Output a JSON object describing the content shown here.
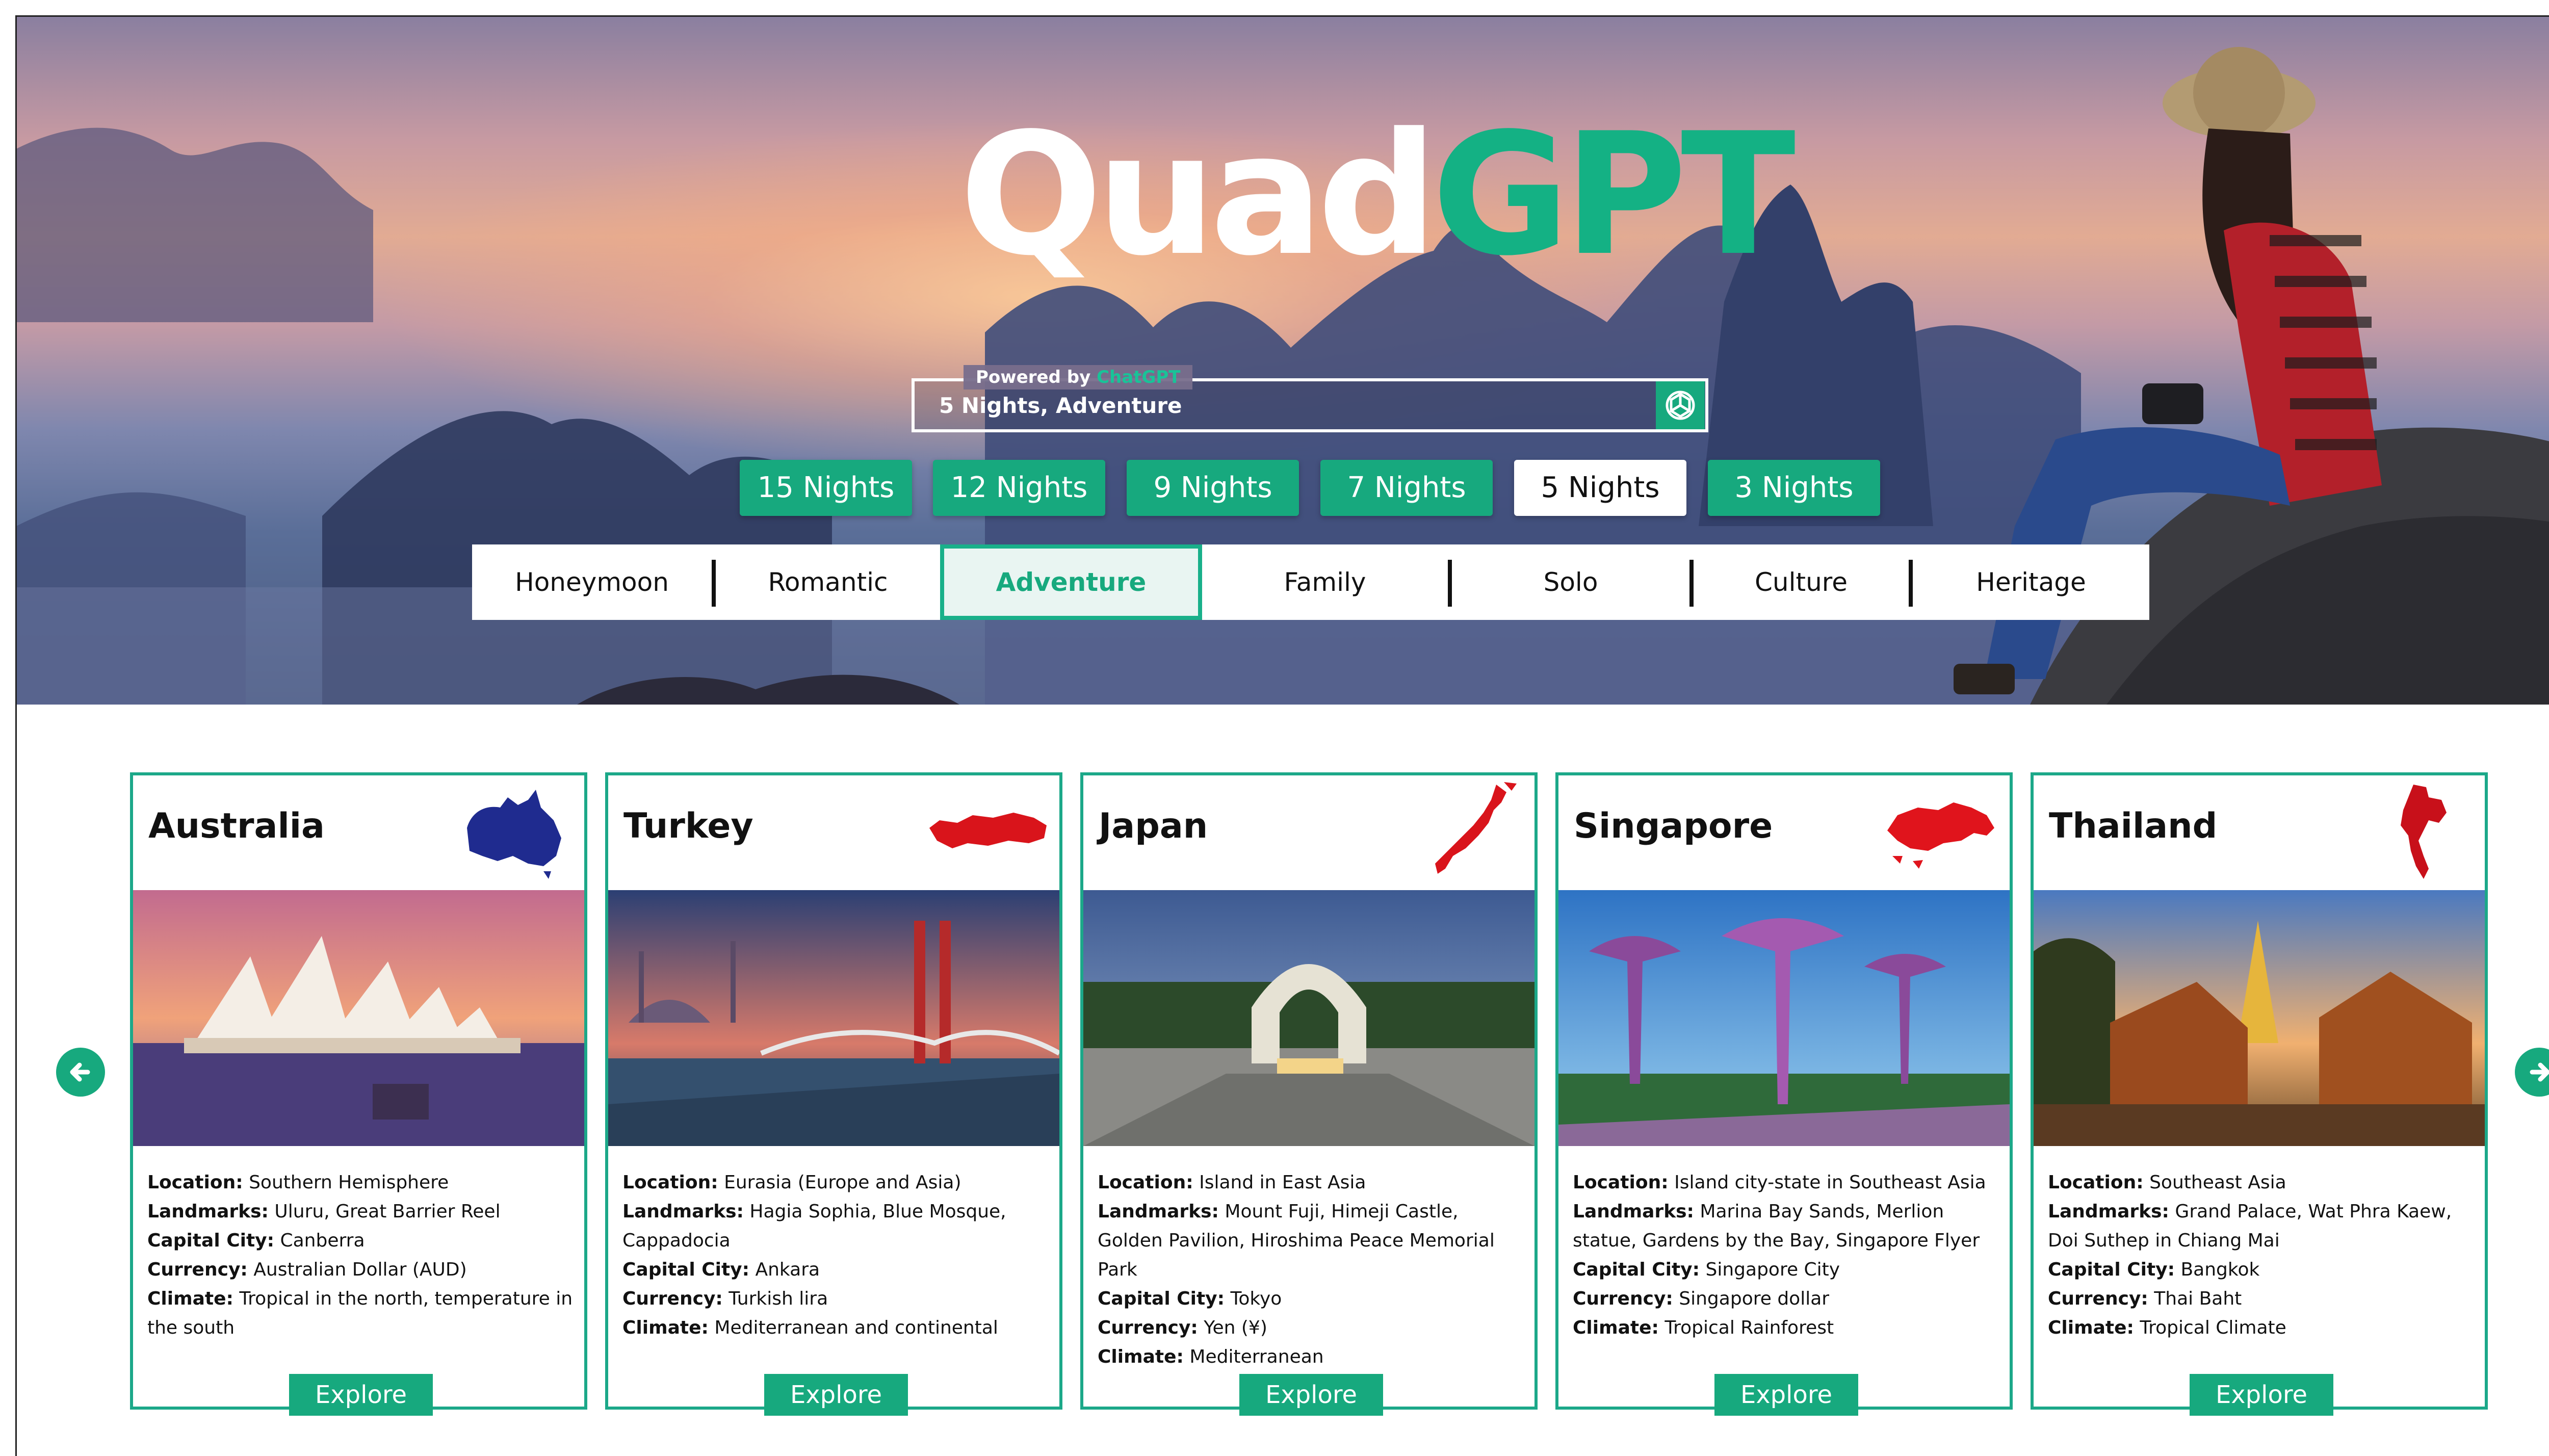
{
  "brand": {
    "logo_part1": "Quad",
    "logo_part2": "GPT",
    "accent": "#17a97e"
  },
  "search": {
    "powered_prefix": "Powered by",
    "powered_brand": "ChatGPT",
    "value": "5 Nights, Adventure",
    "submit_icon": "chatgpt-logo-icon"
  },
  "nights": [
    {
      "label": "15 Nights",
      "selected": false
    },
    {
      "label": "12 Nights",
      "selected": false
    },
    {
      "label": "9 Nights",
      "selected": false
    },
    {
      "label": "7 Nights",
      "selected": false
    },
    {
      "label": "5 Nights",
      "selected": true
    },
    {
      "label": "3 Nights",
      "selected": false
    }
  ],
  "categories": [
    {
      "label": "Honeymoon",
      "selected": false
    },
    {
      "label": "Romantic",
      "selected": false
    },
    {
      "label": "Adventure",
      "selected": true
    },
    {
      "label": "Family",
      "selected": false
    },
    {
      "label": "Solo",
      "selected": false
    },
    {
      "label": "Culture",
      "selected": false
    },
    {
      "label": "Heritage",
      "selected": false
    }
  ],
  "field_labels": {
    "location": "Location:",
    "landmarks": "Landmarks:",
    "capital": "Capital City:",
    "currency": "Currency:",
    "climate": "Climate:"
  },
  "destinations": [
    {
      "name": "Australia",
      "map_color": "#1f2b8f",
      "location": "Southern Hemisphere",
      "landmarks": "Uluru, Great Barrier Reel",
      "capital": "Canberra",
      "currency": "Australian Dollar (AUD)",
      "climate": "Tropical in the north, temperature in the south",
      "cta": "Explore"
    },
    {
      "name": "Turkey",
      "map_color": "#d9141b",
      "location": " Eurasia (Europe and Asia)",
      "landmarks": "Hagia Sophia, Blue Mosque, Cappadocia",
      "capital": "Ankara",
      "currency": "Turkish lira",
      "climate": "Mediterranean and continental",
      "cta": "Explore"
    },
    {
      "name": "Japan",
      "map_color": "#d9141b",
      "location": "Island in East Asia",
      "landmarks": "Mount Fuji, Himeji Castle, Golden Pavilion, Hiroshima Peace Memorial Park",
      "capital": "Tokyo",
      "currency": "Yen (¥)",
      "climate": "Mediterranean",
      "cta": "Explore"
    },
    {
      "name": "Singapore",
      "map_color": "#e0141c",
      "location": "Island city-state in Southeast Asia",
      "landmarks": "Marina Bay Sands, Merlion statue, Gardens by the Bay, Singapore Flyer",
      "capital": "Singapore City",
      "currency": "Singapore dollar",
      "climate": "Tropical Rainforest",
      "cta": "Explore"
    },
    {
      "name": "Thailand",
      "map_color": "#c8101a",
      "location": "Southeast Asia",
      "landmarks": "Grand Palace, Wat Phra Kaew, Doi Suthep in Chiang Mai",
      "capital": "Bangkok",
      "currency": "Thai Baht",
      "climate": "Tropical Climate",
      "cta": "Explore"
    }
  ],
  "carousel": {
    "prev_icon": "arrow-left-icon",
    "next_icon": "arrow-right-icon"
  }
}
